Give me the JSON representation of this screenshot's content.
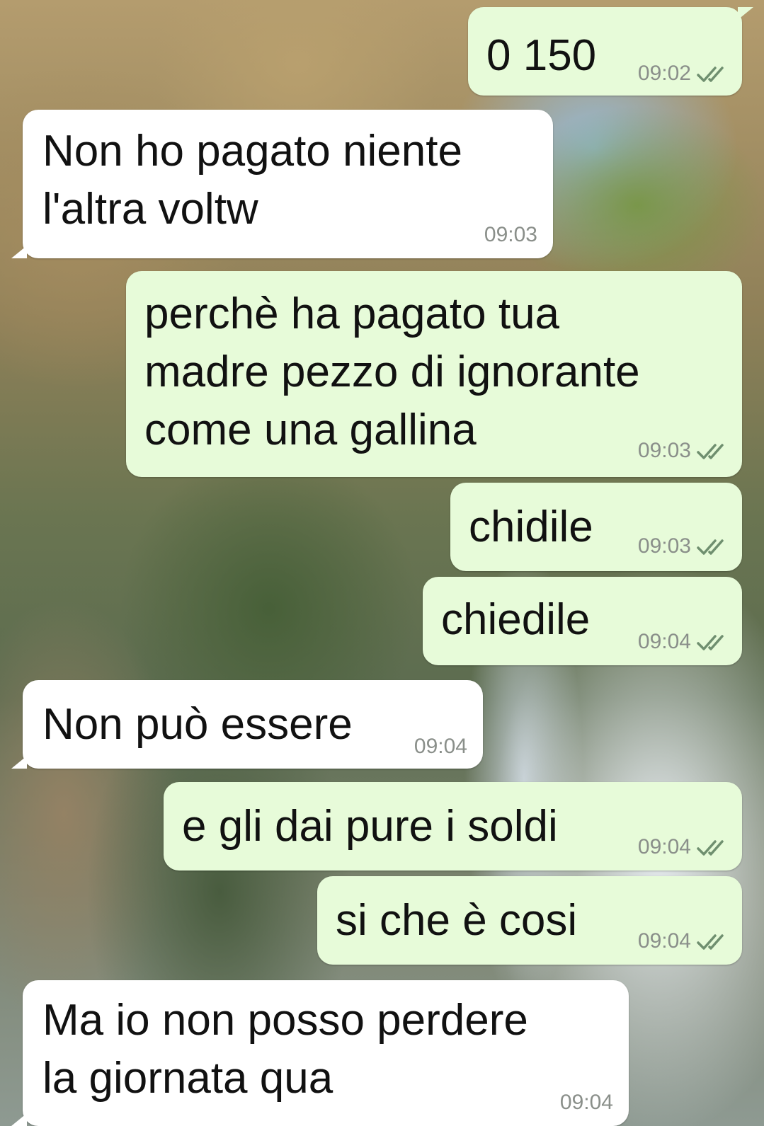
{
  "colors": {
    "outgoing_bubble": "#e7fbd9",
    "incoming_bubble": "#ffffff",
    "text": "#111111",
    "timestamp": "#8a8f8a",
    "read_ticks": "#6f8f6f"
  },
  "messages": [
    {
      "direction": "outgoing",
      "lines": [
        "0 150"
      ],
      "time": "09:02",
      "status_icon": "double-check-icon"
    },
    {
      "direction": "incoming",
      "lines": [
        "Non ho pagato niente",
        "l'altra voltw"
      ],
      "time": "09:03"
    },
    {
      "direction": "outgoing",
      "lines": [
        "perchè ha pagato tua",
        "madre pezzo di ignorante",
        "come una gallina"
      ],
      "time": "09:03",
      "status_icon": "double-check-icon"
    },
    {
      "direction": "outgoing",
      "lines": [
        "chidile"
      ],
      "time": "09:03",
      "status_icon": "double-check-icon"
    },
    {
      "direction": "outgoing",
      "lines": [
        "chiedile"
      ],
      "time": "09:04",
      "status_icon": "double-check-icon"
    },
    {
      "direction": "incoming",
      "lines": [
        "Non può essere"
      ],
      "time": "09:04"
    },
    {
      "direction": "outgoing",
      "lines": [
        "e gli dai pure i soldi"
      ],
      "time": "09:04",
      "status_icon": "double-check-icon"
    },
    {
      "direction": "outgoing",
      "lines": [
        "si che è cosi"
      ],
      "time": "09:04",
      "status_icon": "double-check-icon"
    },
    {
      "direction": "incoming",
      "lines": [
        "Ma io non posso perdere",
        "la giornata qua"
      ],
      "time": "09:04"
    }
  ]
}
